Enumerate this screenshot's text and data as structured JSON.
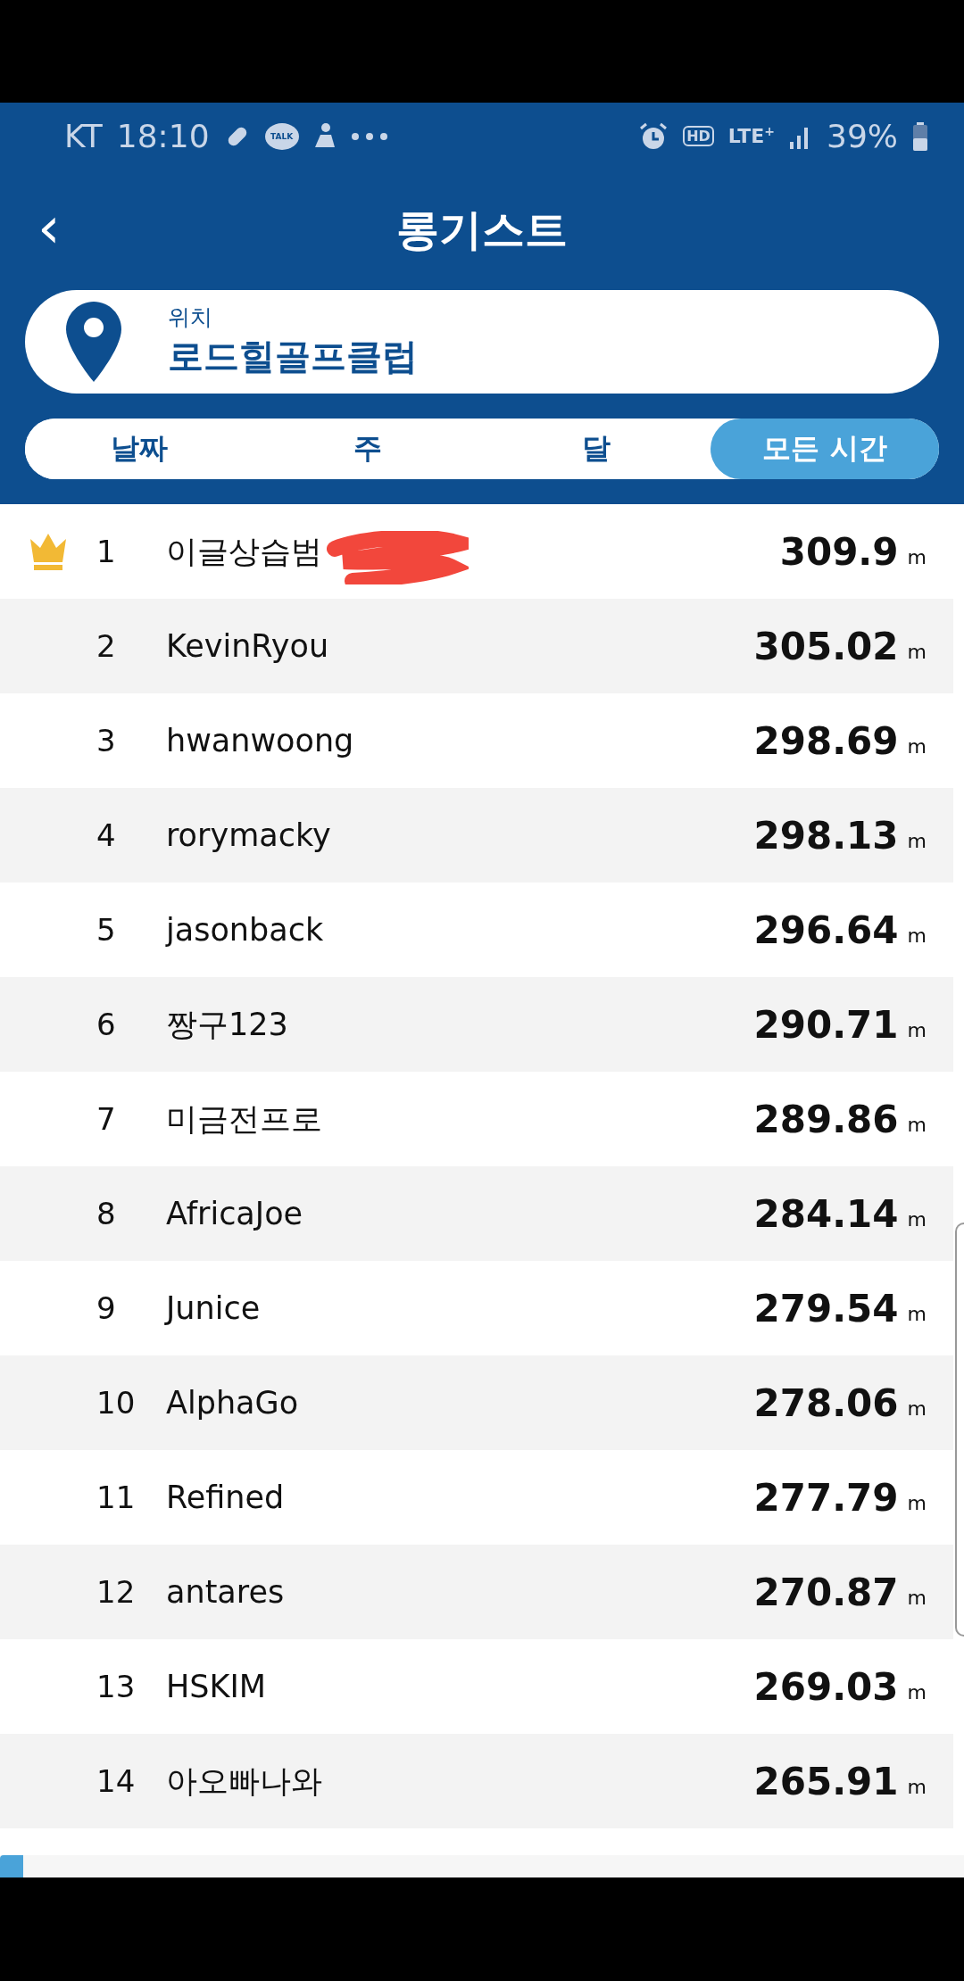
{
  "status_bar": {
    "carrier": "KT",
    "time": "18:10",
    "talk_label": "TALK",
    "hd_label": "HD",
    "network": "LTE$^{+}$",
    "battery": "39%"
  },
  "header": {
    "back": "‹",
    "title": "롱기스트"
  },
  "location": {
    "label": "위치",
    "name": "로드힐골프클럽"
  },
  "tabs": [
    {
      "label": "날짜",
      "selected": false
    },
    {
      "label": "주",
      "selected": false
    },
    {
      "label": "달",
      "selected": false
    },
    {
      "label": "모든 시간",
      "selected": true
    }
  ],
  "rankings": [
    {
      "rank": "1",
      "name": "이글상습범",
      "distance": "309.9",
      "unit": "m",
      "crown": true,
      "redacted": true
    },
    {
      "rank": "2",
      "name": "KevinRyou",
      "distance": "305.02",
      "unit": "m",
      "crown": false,
      "redacted": false
    },
    {
      "rank": "3",
      "name": "hwanwoong",
      "distance": "298.69",
      "unit": "m",
      "crown": false,
      "redacted": false
    },
    {
      "rank": "4",
      "name": "rorymacky",
      "distance": "298.13",
      "unit": "m",
      "crown": false,
      "redacted": false
    },
    {
      "rank": "5",
      "name": "jasonback",
      "distance": "296.64",
      "unit": "m",
      "crown": false,
      "redacted": false
    },
    {
      "rank": "6",
      "name": "짱구123",
      "distance": "290.71",
      "unit": "m",
      "crown": false,
      "redacted": false
    },
    {
      "rank": "7",
      "name": "미금전프로",
      "distance": "289.86",
      "unit": "m",
      "crown": false,
      "redacted": false
    },
    {
      "rank": "8",
      "name": "AfricaJoe",
      "distance": "284.14",
      "unit": "m",
      "crown": false,
      "redacted": false
    },
    {
      "rank": "9",
      "name": "Junice",
      "distance": "279.54",
      "unit": "m",
      "crown": false,
      "redacted": false
    },
    {
      "rank": "10",
      "name": "AlphaGo",
      "distance": "278.06",
      "unit": "m",
      "crown": false,
      "redacted": false
    },
    {
      "rank": "11",
      "name": "Refined",
      "distance": "277.79",
      "unit": "m",
      "crown": false,
      "redacted": false
    },
    {
      "rank": "12",
      "name": "antares",
      "distance": "270.87",
      "unit": "m",
      "crown": false,
      "redacted": false
    },
    {
      "rank": "13",
      "name": "HSKIM",
      "distance": "269.03",
      "unit": "m",
      "crown": false,
      "redacted": false
    },
    {
      "rank": "14",
      "name": "아오빠나와",
      "distance": "265.91",
      "unit": "m",
      "crown": false,
      "redacted": false
    }
  ]
}
